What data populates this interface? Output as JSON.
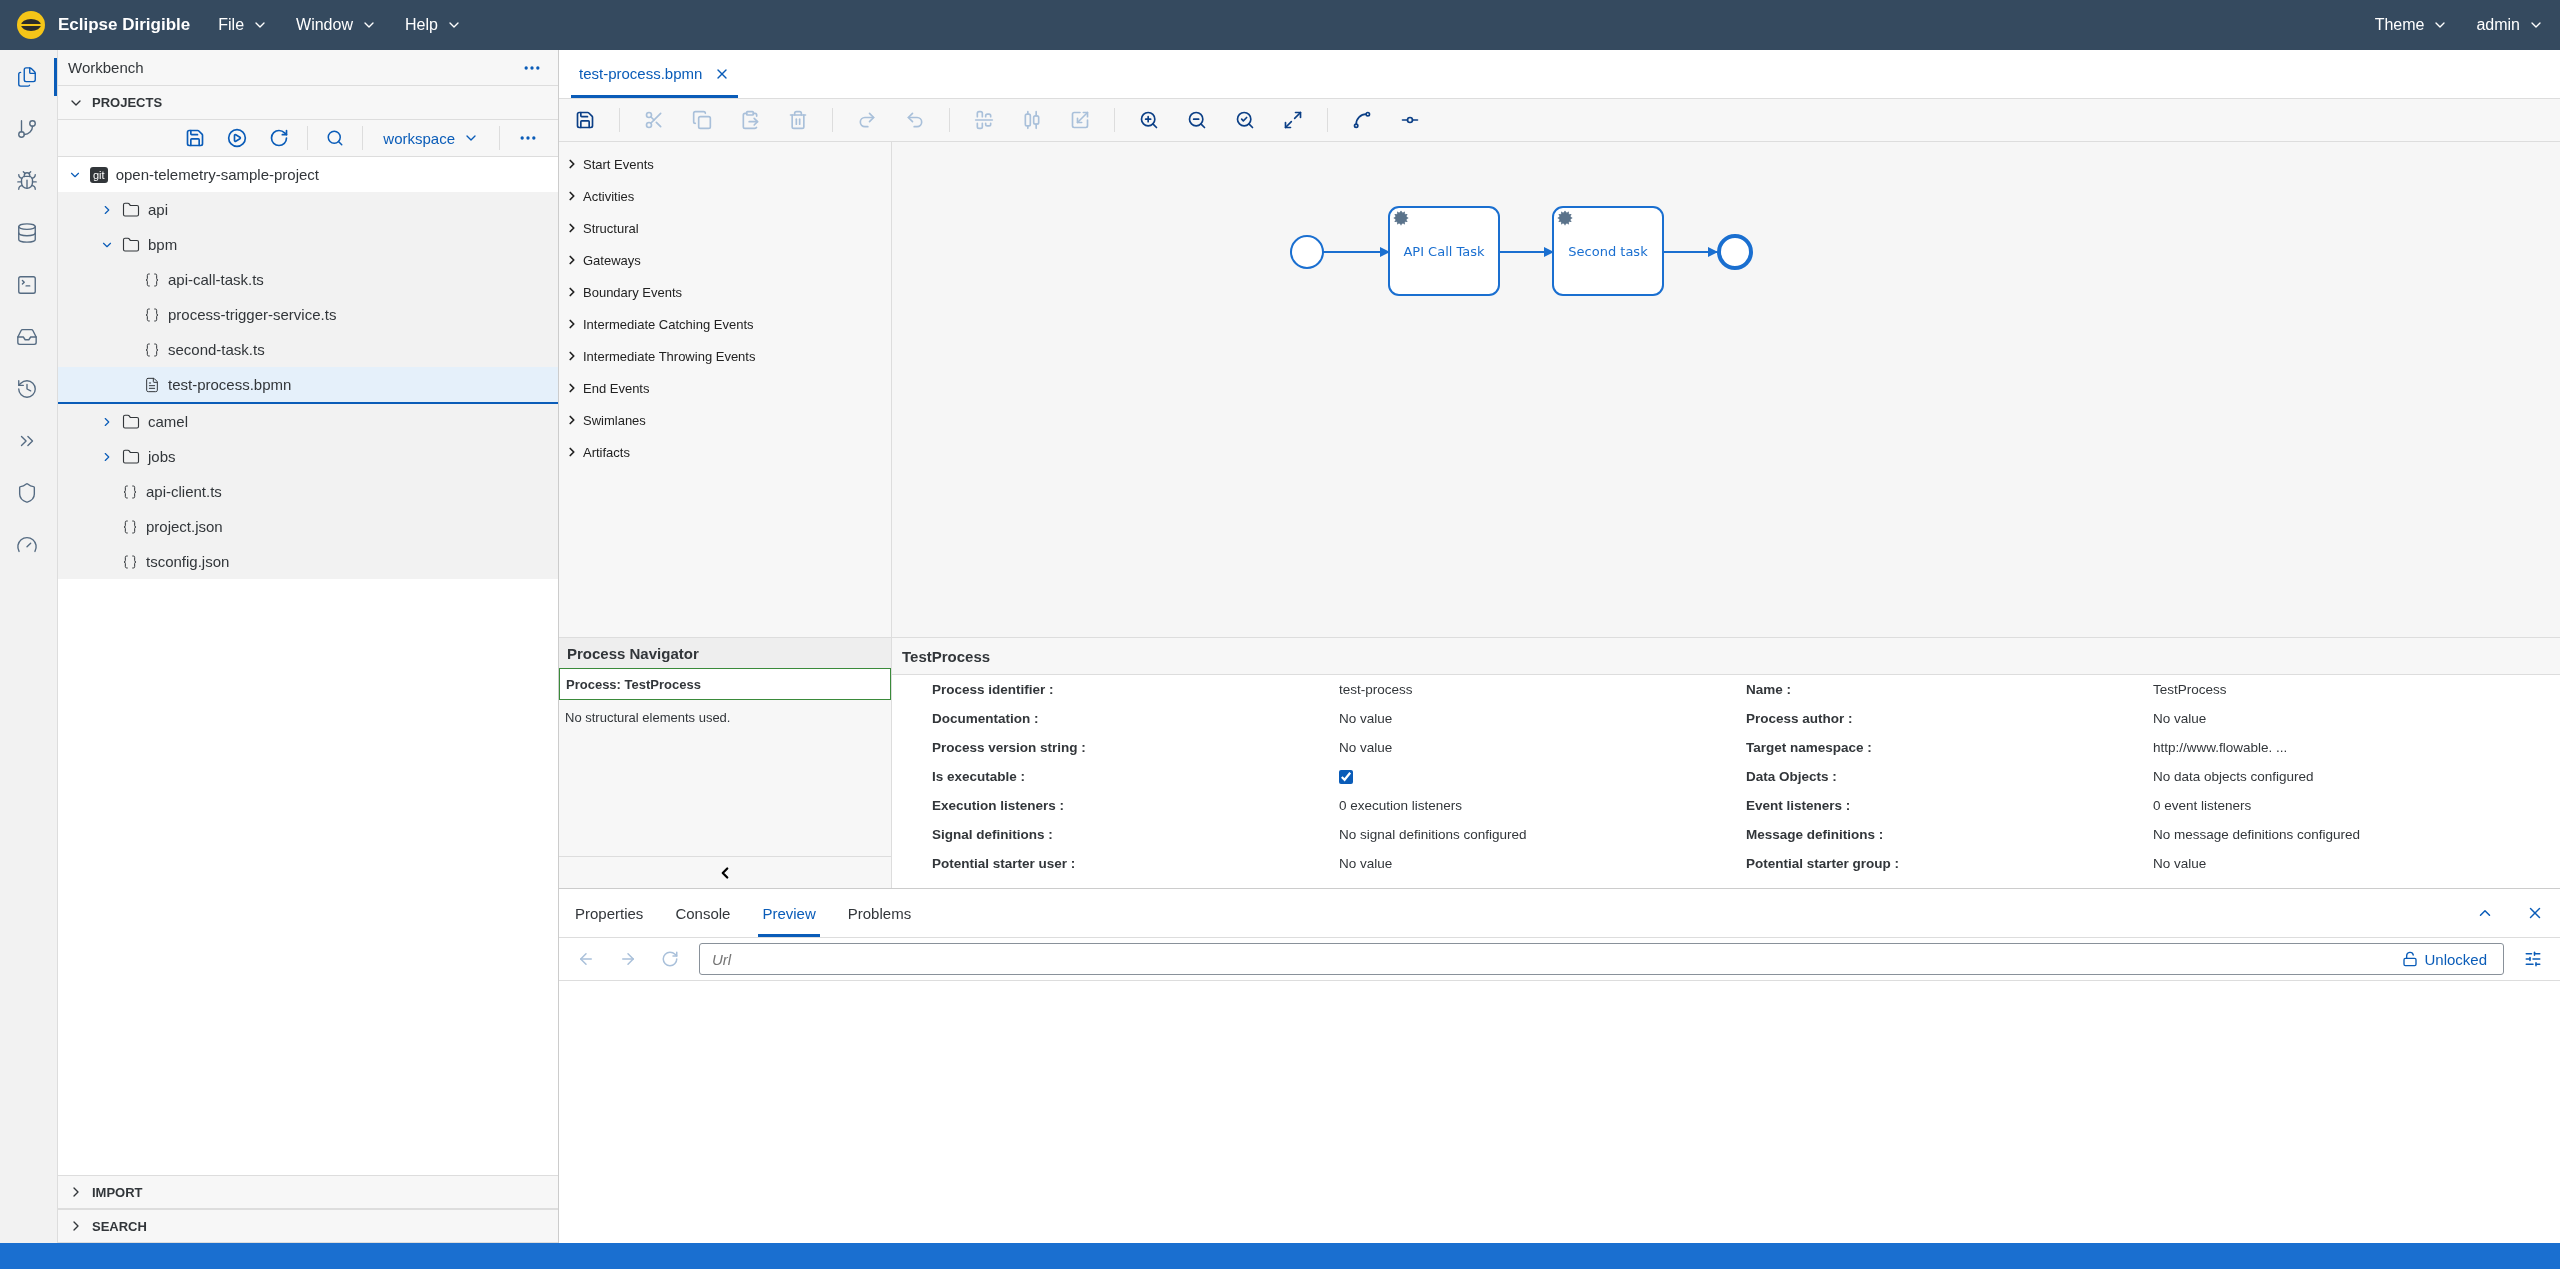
{
  "header": {
    "title": "Eclipse Dirigible",
    "menus": [
      {
        "label": "File"
      },
      {
        "label": "Window"
      },
      {
        "label": "Help"
      }
    ],
    "right_menus": [
      {
        "label": "Theme"
      },
      {
        "label": "admin"
      }
    ]
  },
  "activity_bar": [
    {
      "selected": true
    },
    {
      "selected": false
    },
    {
      "selected": false
    },
    {
      "selected": false
    },
    {
      "selected": false
    },
    {
      "selected": false
    },
    {
      "selected": false
    },
    {
      "selected": false
    },
    {
      "selected": false
    },
    {
      "selected": false
    }
  ],
  "sidebar": {
    "title": "Workbench",
    "section": {
      "title": "PROJECTS",
      "expanded": true
    },
    "workspace": "workspace",
    "tree": [
      {
        "name": "open-telemetry-sample-project",
        "kind": "project",
        "badge": "git",
        "expanded": true,
        "selected": false,
        "children": [
          {
            "name": "api",
            "kind": "folder",
            "expanded": false,
            "selected": false
          },
          {
            "name": "bpm",
            "kind": "folder",
            "expanded": true,
            "selected": false,
            "children": [
              {
                "name": "api-call-task.ts",
                "kind": "script",
                "selected": false
              },
              {
                "name": "process-trigger-service.ts",
                "kind": "script",
                "selected": false
              },
              {
                "name": "second-task.ts",
                "kind": "script",
                "selected": false
              },
              {
                "name": "test-process.bpmn",
                "kind": "document",
                "selected": true
              }
            ]
          },
          {
            "name": "camel",
            "kind": "folder",
            "expanded": false,
            "selected": false
          },
          {
            "name": "jobs",
            "kind": "folder",
            "expanded": false,
            "selected": false
          },
          {
            "name": "api-client.ts",
            "kind": "script",
            "selected": false
          },
          {
            "name": "project.json",
            "kind": "script",
            "selected": false
          },
          {
            "name": "tsconfig.json",
            "kind": "script",
            "selected": false
          }
        ]
      }
    ],
    "bottom_sections": [
      {
        "title": "IMPORT",
        "expanded": false
      },
      {
        "title": "SEARCH",
        "expanded": false
      }
    ]
  },
  "editor": {
    "tabs": [
      {
        "label": "test-process.bpmn",
        "selected": true
      }
    ],
    "toolbar": [
      {
        "disabled": false
      },
      {
        "disabled": true
      },
      {
        "disabled": true
      },
      {
        "disabled": true
      },
      {
        "disabled": true
      },
      {
        "disabled": true
      },
      {
        "disabled": true
      },
      {
        "disabled": true
      },
      {
        "disabled": true
      },
      {
        "disabled": true
      },
      {
        "disabled": false
      },
      {
        "disabled": false
      },
      {
        "disabled": false
      },
      {
        "disabled": false
      },
      {
        "disabled": false
      },
      {
        "disabled": false
      }
    ],
    "palette": [
      "Start Events",
      "Activities",
      "Structural",
      "Gateways",
      "Boundary Events",
      "Intermediate Catching Events",
      "Intermediate Throwing Events",
      "End Events",
      "Swimlanes",
      "Artifacts"
    ],
    "diagram": [
      {
        "kind": "start"
      },
      {
        "kind": "task",
        "label": "API Call Task"
      },
      {
        "kind": "task",
        "label": "Second task"
      },
      {
        "kind": "end"
      }
    ],
    "navigator": {
      "title": "Process Navigator",
      "process": "Process: TestProcess",
      "empty": "No structural elements used."
    },
    "properties": {
      "title": "TestProcess",
      "fields": [
        {
          "label": "Process identifier :",
          "kind": "text",
          "value": "test-process"
        },
        {
          "label": "Name :",
          "kind": "text",
          "value": "TestProcess"
        },
        {
          "label": "Documentation :",
          "kind": "text",
          "value": "No value"
        },
        {
          "label": "Process author :",
          "kind": "text",
          "value": "No value"
        },
        {
          "label": "Process version string :",
          "kind": "text",
          "value": "No value"
        },
        {
          "label": "Target namespace :",
          "kind": "text",
          "value": "http://www.flowable. ..."
        },
        {
          "label": "Is executable :",
          "kind": "checkbox",
          "checked": true
        },
        {
          "label": "Data Objects :",
          "kind": "text",
          "value": "No data objects configured"
        },
        {
          "label": "Execution listeners :",
          "kind": "text",
          "value": "0 execution listeners"
        },
        {
          "label": "Event listeners :",
          "kind": "text",
          "value": "0 event listeners"
        },
        {
          "label": "Signal definitions :",
          "kind": "text",
          "value": "No signal definitions configured"
        },
        {
          "label": "Message definitions :",
          "kind": "text",
          "value": "No message definitions configured"
        },
        {
          "label": "Potential starter user :",
          "kind": "text",
          "value": "No value"
        },
        {
          "label": "Potential starter group :",
          "kind": "text",
          "value": "No value"
        }
      ]
    }
  },
  "bottom_panel": {
    "tabs": [
      {
        "label": "Properties",
        "selected": false
      },
      {
        "label": "Console",
        "selected": false
      },
      {
        "label": "Preview",
        "selected": true
      },
      {
        "label": "Problems",
        "selected": false
      }
    ],
    "nav": [
      {
        "disabled": true
      },
      {
        "disabled": true
      },
      {
        "disabled": true
      }
    ],
    "url_placeholder": "Url",
    "lock_label": "Unlocked"
  }
}
